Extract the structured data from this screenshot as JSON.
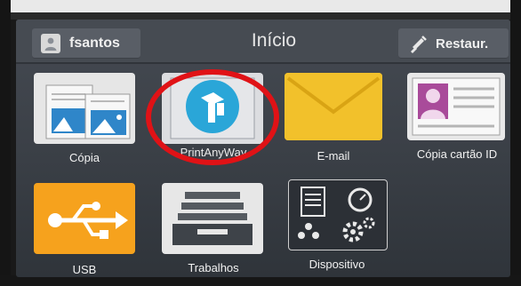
{
  "header": {
    "user_name": "fsantos",
    "title": "Início",
    "restore_label": "Restaur."
  },
  "tiles": [
    {
      "label": "Cópia",
      "icon": "copy-icon"
    },
    {
      "label": "PrintAnyWay",
      "icon": "printanyway-icon"
    },
    {
      "label": "E-mail",
      "icon": "envelope-icon"
    },
    {
      "label": "Cópia cartão ID",
      "icon": "id-card-icon"
    },
    {
      "label": "USB",
      "icon": "usb-icon"
    },
    {
      "label": "Trabalhos",
      "icon": "jobs-tray-icon"
    },
    {
      "label": "Dispositivo",
      "icon": "device-settings-icon"
    }
  ],
  "colors": {
    "email_tile": "#f2c12b",
    "usb_tile": "#f6a21d",
    "printanyway_logo": "#2aa6d8",
    "id_card_photo": "#a94b9a",
    "highlight_circle": "#e01216"
  }
}
